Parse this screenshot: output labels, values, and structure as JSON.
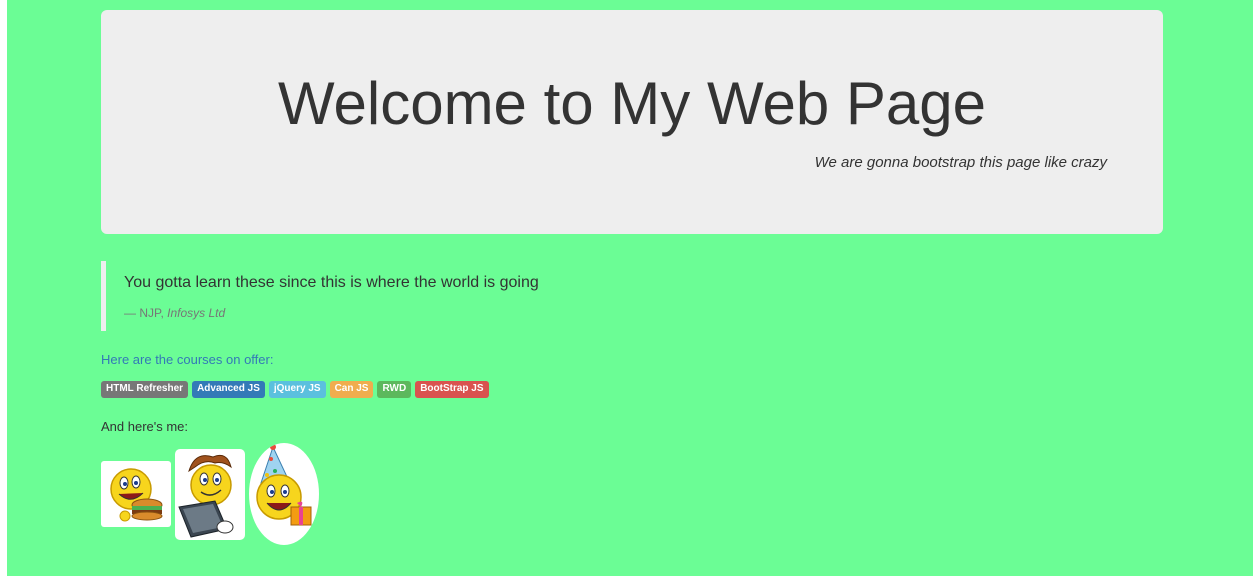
{
  "jumbotron": {
    "title": "Welcome to My Web Page",
    "subtitle": "We are gonna bootstrap this page like crazy"
  },
  "quote": {
    "text": "You gotta learn these since this is where the world is going",
    "author_prefix": "— NJP, ",
    "source": "Infosys Ltd"
  },
  "courses": {
    "intro": "Here are the courses on offer:",
    "labels": [
      {
        "text": "HTML Refresher",
        "color": "#777777"
      },
      {
        "text": "Advanced JS",
        "color": "#337ab7"
      },
      {
        "text": "jQuery JS",
        "color": "#5bc0de"
      },
      {
        "text": "Can JS",
        "color": "#f0ad4e"
      },
      {
        "text": "RWD",
        "color": "#5cb85c"
      },
      {
        "text": "BootStrap JS",
        "color": "#d9534f"
      }
    ]
  },
  "me": {
    "text": "And here's me:",
    "images": [
      {
        "icon": "smiley-burger-image"
      },
      {
        "icon": "smiley-laptop-image"
      },
      {
        "icon": "smiley-party-image"
      }
    ]
  },
  "colors": {
    "page_background": "#6bfd95",
    "jumbotron_background": "#eeeeee",
    "link_text": "#337ab7"
  }
}
